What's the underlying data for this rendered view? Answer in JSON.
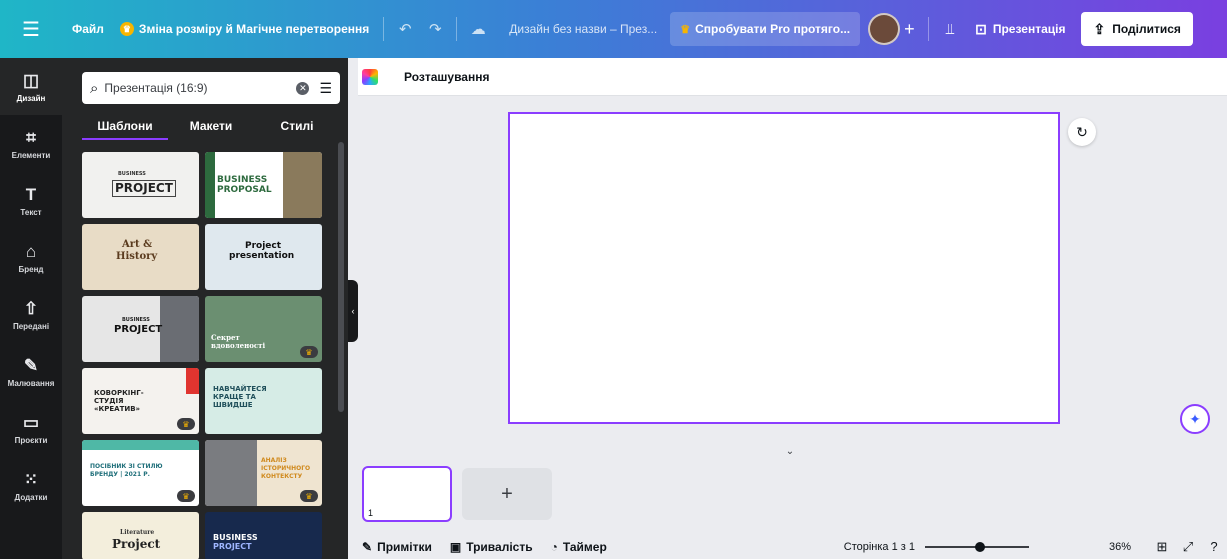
{
  "topbar": {
    "menu_icon": "hamburger-icon",
    "file": "Файл",
    "magic": "Зміна розміру й Магічне перетворення",
    "design_title": "Дизайн без назви – През...",
    "pro_cta": "Спробувати Pro протяго...",
    "present": "Презентація",
    "share": "Поділитися"
  },
  "rail": {
    "items": [
      {
        "label": "Дизайн",
        "icon": "layout-icon"
      },
      {
        "label": "Елементи",
        "icon": "shapes-icon"
      },
      {
        "label": "Текст",
        "icon": "text-icon"
      },
      {
        "label": "Бренд",
        "icon": "brand-icon"
      },
      {
        "label": "Передані",
        "icon": "upload-icon"
      },
      {
        "label": "Малювання",
        "icon": "draw-icon"
      },
      {
        "label": "Проєкти",
        "icon": "folder-icon"
      },
      {
        "label": "Додатки",
        "icon": "apps-icon"
      }
    ]
  },
  "panel": {
    "search_value": "Презентація (16:9)",
    "tabs": [
      "Шаблони",
      "Макети",
      "Стилі"
    ],
    "templates": [
      {
        "line1": "BUSINESS",
        "line2": "PROJECT"
      },
      {
        "line1": "BUSINESS",
        "line2": "PROPOSAL"
      },
      {
        "line1": "Art &",
        "line2": "History"
      },
      {
        "line1": "Project",
        "line2": "presentation"
      },
      {
        "line1": "BUSINESS",
        "line2": "PROJECT"
      },
      {
        "line1": "Секрет",
        "line2": "вдоволеності"
      },
      {
        "line1": "КОВОРКІНГ-",
        "line2": "СТУДІЯ",
        "line3": "«КРЕАТИВ»"
      },
      {
        "line1": "НАВЧАЙТЕСЯ",
        "line2": "КРАЩЕ ТА",
        "line3": "ШВИДШЕ"
      },
      {
        "line1": "ПОСІБНИК ЗІ СТИЛЮ",
        "line2": "БРЕНДУ | 2021 Р."
      },
      {
        "line1": "АНАЛІЗ",
        "line2": "ІСТОРИЧНОГО",
        "line3": "КОНТЕКСТУ"
      },
      {
        "line1": "Literature",
        "line2": "Project"
      },
      {
        "line1": "BUSINESS",
        "line2": "PROJECT"
      }
    ]
  },
  "canvas": {
    "toolbar_label": "Розташування",
    "page_number": "1"
  },
  "footer": {
    "notes": "Примітки",
    "duration": "Тривалість",
    "timer": "Таймер",
    "page_of": "Сторінка 1 з 1",
    "zoom": "36%",
    "zoom_fraction": 0.36
  }
}
